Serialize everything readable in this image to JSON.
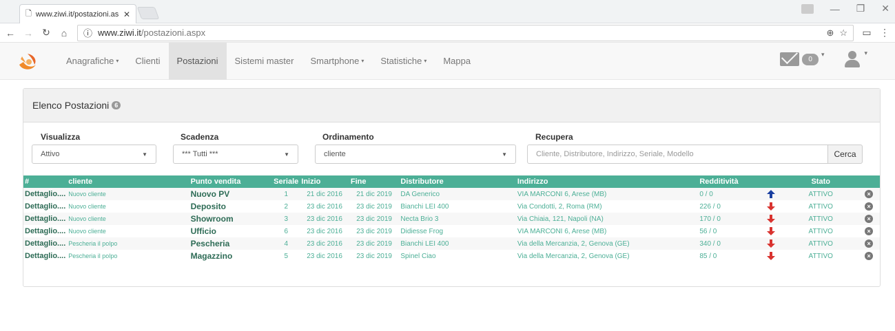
{
  "browser": {
    "tab_title": "www.ziwi.it/postazioni.as",
    "url_host": "www.ziwi.it",
    "url_path": "/postazioni.aspx"
  },
  "navbar": {
    "items": [
      {
        "label": "Anagrafiche",
        "caret": true,
        "active": false
      },
      {
        "label": "Clienti",
        "caret": false,
        "active": false
      },
      {
        "label": "Postazioni",
        "caret": false,
        "active": true
      },
      {
        "label": "Sistemi master",
        "caret": false,
        "active": false
      },
      {
        "label": "Smartphone",
        "caret": true,
        "active": false
      },
      {
        "label": "Statistiche",
        "caret": true,
        "active": false
      },
      {
        "label": "Mappa",
        "caret": false,
        "active": false
      }
    ],
    "mail_count": "0"
  },
  "panel": {
    "title": "Elenco Postazioni",
    "count": "6"
  },
  "filters": {
    "visualizza_label": "Visualizza",
    "visualizza_value": "Attivo",
    "scadenza_label": "Scadenza",
    "scadenza_value": "*** Tutti ***",
    "ordinamento_label": "Ordinamento",
    "ordinamento_value": "cliente",
    "recupera_label": "Recupera",
    "recupera_placeholder": "Cliente, Distributore, Indirizzo, Seriale, Modello",
    "search_button": "Cerca"
  },
  "table": {
    "headers": [
      "#",
      "cliente",
      "Punto vendita",
      "Seriale",
      "Inizio",
      "Fine",
      "Distributore",
      "Indirizzo",
      "Redditività",
      "",
      "Stato",
      ""
    ],
    "rows": [
      {
        "det": "Dettaglio....",
        "cliente": "Nuovo cliente",
        "pv": "Nuovo PV",
        "seriale": "1",
        "inizio": "21 dic 2016",
        "fine": "21 dic 2019",
        "distributore": "DA Generico",
        "indirizzo": "VIA MARCONI 6, Arese (MB)",
        "redditivita": "0 / 0",
        "trend": "up",
        "stato": "ATTIVO"
      },
      {
        "det": "Dettaglio....",
        "cliente": "Nuovo cliente",
        "pv": "Deposito",
        "seriale": "2",
        "inizio": "23 dic 2016",
        "fine": "23 dic 2019",
        "distributore": "Bianchi LEI 400",
        "indirizzo": "Via Condotti, 2, Roma (RM)",
        "redditivita": "226 / 0",
        "trend": "down",
        "stato": "ATTIVO"
      },
      {
        "det": "Dettaglio....",
        "cliente": "Nuovo cliente",
        "pv": "Showroom",
        "seriale": "3",
        "inizio": "23 dic 2016",
        "fine": "23 dic 2019",
        "distributore": "Necta Brio 3",
        "indirizzo": "Via Chiaia, 121, Napoli (NA)",
        "redditivita": "170 / 0",
        "trend": "down",
        "stato": "ATTIVO"
      },
      {
        "det": "Dettaglio....",
        "cliente": "Nuovo cliente",
        "pv": "Ufficio",
        "seriale": "6",
        "inizio": "23 dic 2016",
        "fine": "23 dic 2019",
        "distributore": "Didiesse Frog",
        "indirizzo": "VIA MARCONI 6, Arese (MB)",
        "redditivita": "56 / 0",
        "trend": "down",
        "stato": "ATTIVO"
      },
      {
        "det": "Dettaglio....",
        "cliente": "Pescheria il polpo",
        "pv": "Pescheria",
        "seriale": "4",
        "inizio": "23 dic 2016",
        "fine": "23 dic 2019",
        "distributore": "Bianchi LEI 400",
        "indirizzo": "Via della Mercanzia, 2, Genova (GE)",
        "redditivita": "340 / 0",
        "trend": "down",
        "stato": "ATTIVO"
      },
      {
        "det": "Dettaglio....",
        "cliente": "Pescheria il polpo",
        "pv": "Magazzino",
        "seriale": "5",
        "inizio": "23 dic 2016",
        "fine": "23 dic 2019",
        "distributore": "Spinel Ciao",
        "indirizzo": "Via della Mercanzia, 2, Genova (GE)",
        "redditivita": "85 / 0",
        "trend": "down",
        "stato": "ATTIVO"
      }
    ]
  },
  "colors": {
    "table_header": "#4caf96",
    "arrow_up": "#1a3fa0",
    "arrow_down": "#d9332f"
  }
}
